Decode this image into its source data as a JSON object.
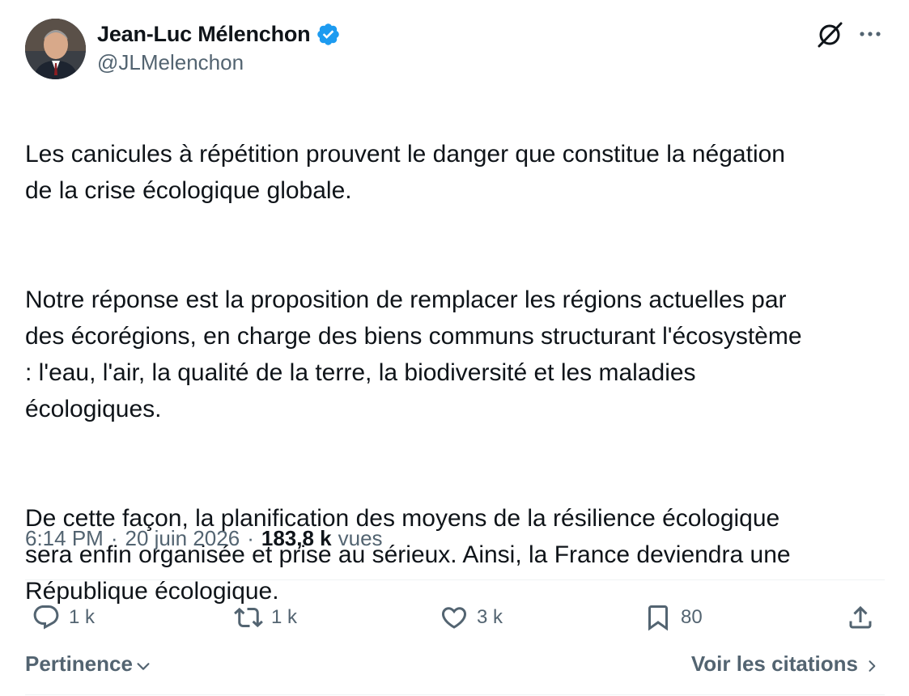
{
  "author": {
    "name": "Jean-Luc Mélenchon",
    "handle": "@JLMelenchon",
    "verified": true
  },
  "tweet": {
    "paragraphs": [
      "Les canicules à répétition prouvent le danger que constitue la négation\nde la crise écologique globale.",
      "Notre réponse est la proposition de remplacer les régions actuelles par\ndes écorégions, en charge des biens communs structurant l'écosystème\n: l'eau, l'air, la qualité de la terre, la biodiversité et les maladies\nécologiques.",
      "De cette façon, la planification des moyens de la résilience écologique\nsera enfin organisée et prise au sérieux. Ainsi, la France deviendra une\nRépublique écologique."
    ]
  },
  "meta": {
    "time": "6:14 PM",
    "separator": "·",
    "date": "20 juin 2026",
    "views_count": "183,8 k",
    "views_label": "vues"
  },
  "actions": {
    "replies": "1 k",
    "reposts": "1 k",
    "likes": "3 k",
    "bookmarks": "80"
  },
  "footer": {
    "sort_label": "Pertinence",
    "quotes_label": "Voir les citations"
  },
  "icons": {
    "verified": "verified-badge-icon",
    "grok": "grok-icon",
    "more": "more-icon",
    "reply": "reply-icon",
    "repost": "repost-icon",
    "like": "heart-icon",
    "bookmark": "bookmark-icon",
    "share": "share-icon",
    "chevron_down": "chevron-down-icon",
    "chevron_right": "chevron-right-icon"
  },
  "colors": {
    "text_primary": "#0f1419",
    "text_secondary": "#536471",
    "verified_blue": "#1d9bf0",
    "divider": "#eff3f4"
  }
}
